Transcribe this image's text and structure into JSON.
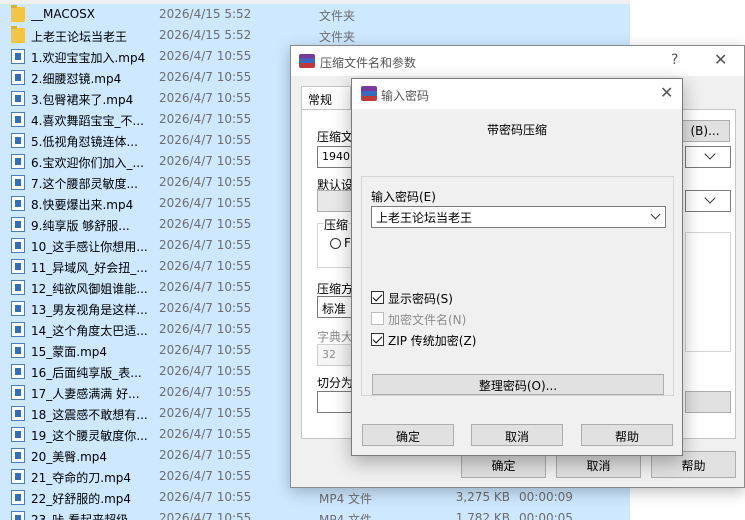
{
  "explorer": {
    "rows": [
      {
        "name": "__MACOSX",
        "date": "2026/4/15 5:52",
        "type": "文件夹",
        "size": "",
        "duration": "",
        "kind": "folder"
      },
      {
        "name": "上老王论坛当老王",
        "date": "2026/4/15 5:52",
        "type": "文件夹",
        "size": "",
        "duration": "",
        "kind": "folder"
      },
      {
        "name": "1.欢迎宝宝加入.mp4",
        "date": "2026/4/7 10:55",
        "type": "",
        "size": "",
        "duration": "",
        "kind": "mp4"
      },
      {
        "name": "2.细腰怼镜.mp4",
        "date": "2026/4/7 10:55",
        "type": "",
        "size": "",
        "duration": "",
        "kind": "mp4"
      },
      {
        "name": "3.包臀裙来了.mp4",
        "date": "2026/4/7 10:55",
        "type": "",
        "size": "",
        "duration": "",
        "kind": "mp4"
      },
      {
        "name": "4.喜欢舞蹈宝宝_不...",
        "date": "2026/4/7 10:55",
        "type": "",
        "size": "",
        "duration": "",
        "kind": "mp4"
      },
      {
        "name": "5.低视角怼镜连体...",
        "date": "2026/4/7 10:55",
        "type": "",
        "size": "",
        "duration": "",
        "kind": "mp4"
      },
      {
        "name": "6.宝欢迎你们加入_...",
        "date": "2026/4/7 10:55",
        "type": "",
        "size": "",
        "duration": "",
        "kind": "mp4"
      },
      {
        "name": "7.这个腰部灵敏度...",
        "date": "2026/4/7 10:55",
        "type": "",
        "size": "",
        "duration": "",
        "kind": "mp4"
      },
      {
        "name": "8.快要爆出来.mp4",
        "date": "2026/4/7 10:55",
        "type": "",
        "size": "",
        "duration": "",
        "kind": "mp4"
      },
      {
        "name": "9.纯享版 够舒服...",
        "date": "2026/4/7 10:55",
        "type": "",
        "size": "",
        "duration": "",
        "kind": "mp4"
      },
      {
        "name": "10_这手感让你想用...",
        "date": "2026/4/7 10:55",
        "type": "",
        "size": "",
        "duration": "",
        "kind": "mp4"
      },
      {
        "name": "11_异域风_好会扭_...",
        "date": "2026/4/7 10:55",
        "type": "",
        "size": "",
        "duration": "",
        "kind": "mp4"
      },
      {
        "name": "12_纯欲风御姐谁能...",
        "date": "2026/4/7 10:55",
        "type": "",
        "size": "",
        "duration": "",
        "kind": "mp4"
      },
      {
        "name": "13_男友视角是这样...",
        "date": "2026/4/7 10:55",
        "type": "",
        "size": "",
        "duration": "",
        "kind": "mp4"
      },
      {
        "name": "14_这个角度太巴适...",
        "date": "2026/4/7 10:55",
        "type": "",
        "size": "",
        "duration": "",
        "kind": "mp4"
      },
      {
        "name": "15_蒙面.mp4",
        "date": "2026/4/7 10:55",
        "type": "",
        "size": "",
        "duration": "",
        "kind": "mp4"
      },
      {
        "name": "16_后面纯享版_表...",
        "date": "2026/4/7 10:55",
        "type": "",
        "size": "",
        "duration": "",
        "kind": "mp4"
      },
      {
        "name": "17_人妻感满满 好...",
        "date": "2026/4/7 10:55",
        "type": "",
        "size": "",
        "duration": "",
        "kind": "mp4"
      },
      {
        "name": "18_这震感不敢想有...",
        "date": "2026/4/7 10:55",
        "type": "",
        "size": "",
        "duration": "",
        "kind": "mp4"
      },
      {
        "name": "19_这个腰灵敏度你...",
        "date": "2026/4/7 10:55",
        "type": "",
        "size": "",
        "duration": "",
        "kind": "mp4"
      },
      {
        "name": "20_美臀.mp4",
        "date": "2026/4/7 10:55",
        "type": "",
        "size": "",
        "duration": "",
        "kind": "mp4"
      },
      {
        "name": "21_夺命的刀.mp4",
        "date": "2026/4/7 10:55",
        "type": "",
        "size": "",
        "duration": "",
        "kind": "mp4"
      },
      {
        "name": "22_好舒服的.mp4",
        "date": "2026/4/7 10:55",
        "type": "MP4 文件",
        "size": "3,275 KB",
        "duration": "00:00:09",
        "kind": "mp4"
      },
      {
        "name": "23_咔 看起来超级...",
        "date": "2026/4/7 10:55",
        "type": "MP4 文件",
        "size": "1,782 KB",
        "duration": "00:00:05",
        "kind": "mp4"
      }
    ]
  },
  "parent_dialog": {
    "title": "压缩文件名和参数",
    "help": "?",
    "close": "✕",
    "tab_general": "常规",
    "label_archive_name": "压缩文",
    "archive_name_value": "1940.z",
    "browse_button": "(B)...",
    "label_default": "默认设",
    "label_compress_format": "压缩",
    "radio_label": "F",
    "label_compress_method": "压缩方",
    "method_value": "标准",
    "label_dict_size": "字典大",
    "dict_value": "32",
    "label_split": "切分为",
    "ok_button": "确定",
    "cancel_button": "取消",
    "help_button": "帮助"
  },
  "password_dialog": {
    "title": "输入密码",
    "close": "✕",
    "heading": "带密码压缩",
    "label_enter_password": "输入密码(E)",
    "password_value": "上老王论坛当老王",
    "show_password": {
      "label": "显示密码(S)",
      "checked": true,
      "disabled": false
    },
    "encrypt_filenames": {
      "label": "加密文件名(N)",
      "checked": false,
      "disabled": true
    },
    "zip_legacy": {
      "label": "ZIP 传统加密(Z)",
      "checked": true,
      "disabled": false
    },
    "organize_button": "整理密码(O)...",
    "ok_button": "确定",
    "cancel_button": "取消",
    "help_button": "帮助"
  },
  "colors": {
    "selection": "#cde8ff",
    "dialog_bg": "#f0f0f0",
    "button_bg": "#e1e1e1"
  }
}
